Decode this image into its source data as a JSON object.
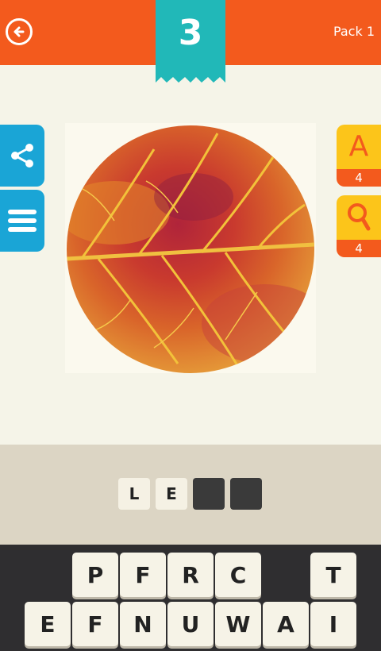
{
  "header": {
    "pack_label": "Pack 1",
    "level_number": "3",
    "back_icon": "arrow-left-circle-icon"
  },
  "sidebar_left": {
    "share_icon": "share-icon",
    "menu_icon": "hamburger-menu-icon"
  },
  "hints": {
    "reveal_letter": {
      "label": "A",
      "count": "4"
    },
    "magnify": {
      "icon": "magnifier-icon",
      "count": "4"
    }
  },
  "answer": {
    "tiles": [
      "L",
      "E",
      "",
      ""
    ]
  },
  "keyboard": {
    "row1": [
      "P",
      "F",
      "R",
      "C",
      "",
      "T"
    ],
    "row2": [
      "E",
      "F",
      "N",
      "U",
      "W",
      "A",
      "I"
    ]
  },
  "colors": {
    "header": "#f35a1d",
    "level_ribbon": "#21b8b8",
    "side_buttons": "#1aa5d6",
    "hint_yellow": "#fcc51a",
    "answer_band": "#dcd5c4",
    "keyboard_bg": "#2f2e30"
  }
}
